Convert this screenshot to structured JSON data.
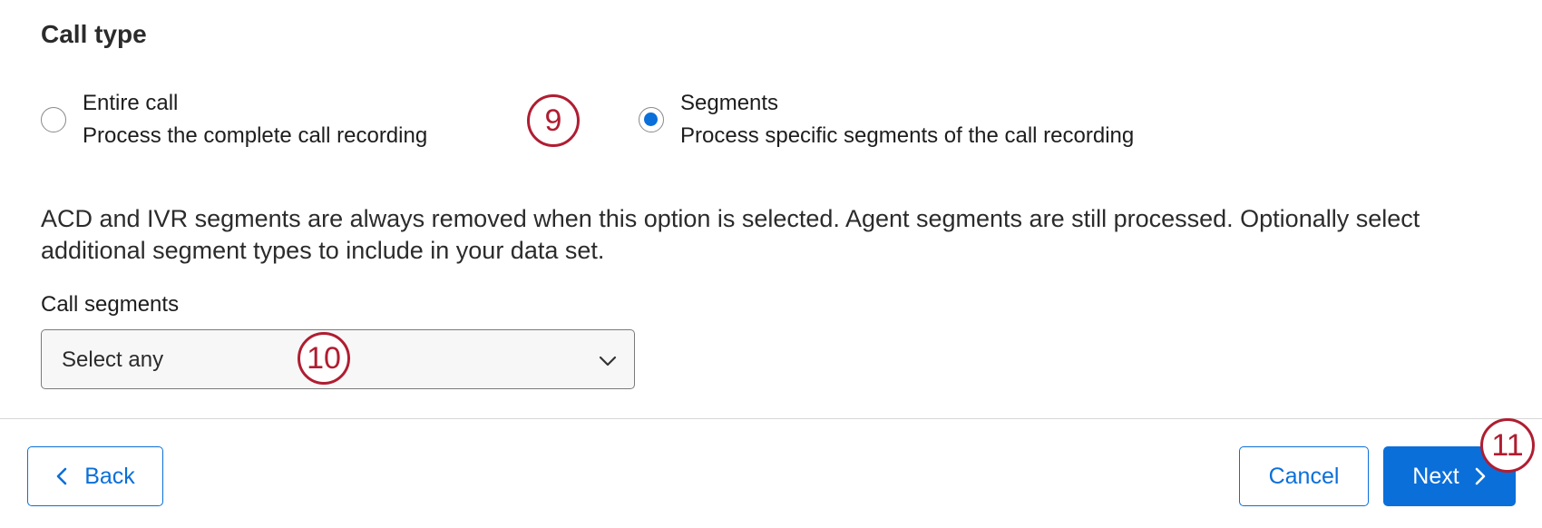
{
  "section": {
    "title": "Call type"
  },
  "call_type_options": [
    {
      "title": "Entire call",
      "description": "Process the complete call recording",
      "selected": false
    },
    {
      "title": "Segments",
      "description": "Process specific segments of the call recording",
      "selected": true
    }
  ],
  "info_text": "ACD and IVR segments are always removed when this option is selected. Agent segments are still processed. Optionally select additional segment types to include in your data set.",
  "call_segments": {
    "label": "Call segments",
    "placeholder": "Select any"
  },
  "footer": {
    "back_label": "Back",
    "cancel_label": "Cancel",
    "next_label": "Next"
  },
  "callouts": [
    "9",
    "10",
    "11"
  ],
  "colors": {
    "accent": "#0a6fd9",
    "callout": "#b01d31"
  },
  "icons": {
    "back": "chevron-left-icon",
    "next": "chevron-right-icon",
    "dropdown": "chevron-down-icon"
  }
}
